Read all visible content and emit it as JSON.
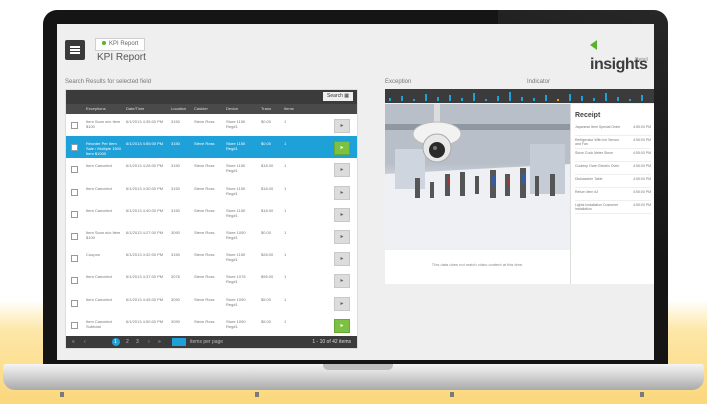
{
  "header": {
    "breadcrumb": "KPI Report",
    "title": "KPI Report",
    "logo_text": "insights",
    "logo_sub": "Retail"
  },
  "left_panel": {
    "section_label": "Search Results for selected field",
    "search_button": "Search",
    "columns": [
      "Exceptions",
      "Date/Time",
      "Location",
      "Cashier",
      "Device",
      "Trans",
      "Items"
    ],
    "rows": [
      {
        "exception": "Item Scan w/o Item $100",
        "datetime": "6/1/2013 4:35:00 PM",
        "location": "3150",
        "cashier": "Steve Ross",
        "device": "Store 1150 Reg#1",
        "amount": "$0.00",
        "items": "1",
        "selected": false,
        "action": "▸",
        "green": false
      },
      {
        "exception": "Reorder Per Item Sale / Multiple 1500 Item $1000",
        "datetime": "6/1/2013 4:55:00 PM",
        "location": "3150",
        "cashier": "Steve Ross",
        "device": "Store 1150 Reg#1",
        "amount": "$0.00",
        "items": "1",
        "selected": true,
        "action": "▸",
        "green": true
      },
      {
        "exception": "Item Canceled",
        "datetime": "6/1/2013 4:28:00 PM",
        "location": "3150",
        "cashier": "Steve Ross",
        "device": "Store 1150 Reg#1",
        "amount": "$18.00",
        "items": "1",
        "selected": false,
        "action": "▸",
        "green": false
      },
      {
        "exception": "Item Canceled",
        "datetime": "6/1/2013 4:30:00 PM",
        "location": "3150",
        "cashier": "Steve Ross",
        "device": "Store 1150 Reg#1",
        "amount": "$18.00",
        "items": "1",
        "selected": false,
        "action": "▸",
        "green": false
      },
      {
        "exception": "Item Canceled",
        "datetime": "6/1/2013 4:40:00 PM",
        "location": "3150",
        "cashier": "Steve Ross",
        "device": "Store 1150 Reg#1",
        "amount": "$18.00",
        "items": "1",
        "selected": false,
        "action": "▸",
        "green": false
      },
      {
        "exception": "Item Scan w/o Item $100",
        "datetime": "6/1/2013 4:27:00 PM",
        "location": "3090",
        "cashier": "Steve Ross",
        "device": "Store 1090 Reg#1",
        "amount": "$0.00",
        "items": "1",
        "selected": false,
        "action": "▸",
        "green": false
      },
      {
        "exception": "Coupon",
        "datetime": "6/1/2013 4:32:00 PM",
        "location": "3150",
        "cashier": "Steve Ross",
        "device": "Store 1150 Reg#1",
        "amount": "$28.00",
        "items": "1",
        "selected": false,
        "action": "▸",
        "green": false
      },
      {
        "exception": "Item Canceled",
        "datetime": "6/1/2013 4:37:00 PM",
        "location": "3076",
        "cashier": "Steve Ross",
        "device": "Store 1076 Reg#1",
        "amount": "$95.00",
        "items": "1",
        "selected": false,
        "action": "▸",
        "green": false
      },
      {
        "exception": "Item Canceled",
        "datetime": "6/1/2013 4:45:00 PM",
        "location": "3090",
        "cashier": "Steve Ross",
        "device": "Store 1090 Reg#1",
        "amount": "$5.00",
        "items": "1",
        "selected": false,
        "action": "▸",
        "green": false
      },
      {
        "exception": "Item Canceled Subtotal",
        "datetime": "6/1/2013 4:50:00 PM",
        "location": "3090",
        "cashier": "Steve Ross",
        "device": "Store 1090 Reg#1",
        "amount": "$5.00",
        "items": "1",
        "selected": false,
        "action": "▸",
        "green": true
      }
    ],
    "pager": {
      "first": "«",
      "prev": "‹",
      "current": "1",
      "p2": "2",
      "p3": "3",
      "next": "›",
      "last": "»",
      "per_page_label": "items per page",
      "summary": "1 - 10 of 42 items"
    }
  },
  "right_panel": {
    "label_left": "Exception",
    "label_right": "Indicator",
    "video_caption": "This data does not match video content at this time.",
    "receipt": {
      "title": "Receipt",
      "lines": [
        {
          "item": "Japanese Item Special Order",
          "time": "4:55:00 PM"
        },
        {
          "item": "Refrigerator With Ice Sensor and Fan",
          "time": "4:55:00 PM"
        },
        {
          "item": "Stove Cook Meter Stove",
          "time": "4:55:00 PM"
        },
        {
          "item": "Cooktop Oven Electric Oven",
          "time": "4:55:00 PM"
        },
        {
          "item": "Dishwasher Table",
          "time": "4:55:00 PM"
        },
        {
          "item": "Return Item #2",
          "time": "4:55:00 PM"
        },
        {
          "item": "Lights Installation Customer Installation",
          "time": "4:55:00 PM"
        }
      ]
    }
  },
  "colors": {
    "accent": "#1ea0d8",
    "green": "#7cc142",
    "dark": "#3b3b3b"
  }
}
